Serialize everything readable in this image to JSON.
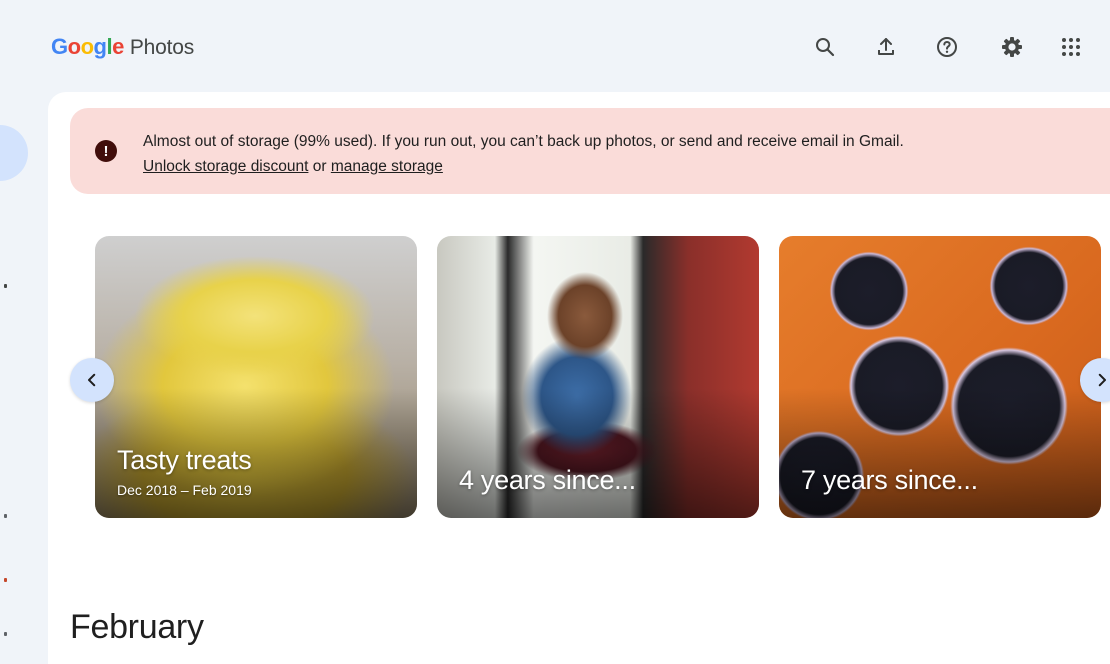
{
  "app": {
    "logo_google": [
      "G",
      "o",
      "o",
      "g",
      "l",
      "e"
    ],
    "logo_product": "Photos"
  },
  "toolbar": {
    "icons": [
      "search-icon",
      "upload-icon",
      "help-icon",
      "settings-icon",
      "apps-icon"
    ]
  },
  "banner": {
    "message": "Almost out of storage (99% used). If you run out, you can’t back up photos, or send and receive email in Gmail.",
    "link_unlock": "Unlock storage discount",
    "separator": "or",
    "link_manage": "manage storage",
    "icon": "!"
  },
  "memories": [
    {
      "title": "Tasty treats",
      "subtitle": "Dec 2018 – Feb 2019"
    },
    {
      "title": "4 years since...",
      "subtitle": ""
    },
    {
      "title": "7 years since...",
      "subtitle": ""
    }
  ],
  "nav": {
    "prev": "‹",
    "next": "›"
  },
  "section": {
    "title": "February"
  },
  "colors": {
    "background": "#f0f4f9",
    "banner": "#fadcd9",
    "accent_pill": "#d3e3fd"
  }
}
